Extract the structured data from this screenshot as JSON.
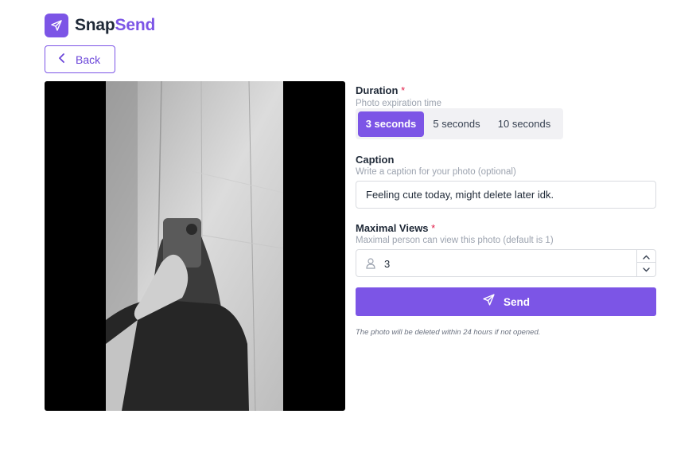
{
  "brand": {
    "name_main": "Snap",
    "name_accent": "Send",
    "logo_icon": "paper-plane-icon",
    "accent_color": "#7c55e6"
  },
  "back": {
    "label": "Back",
    "icon": "chevron-left-icon"
  },
  "photo": {
    "description_icon": "photo-preview"
  },
  "duration": {
    "label": "Duration",
    "required_mark": "*",
    "hint": "Photo expiration time",
    "options": [
      "3 seconds",
      "5 seconds",
      "10 seconds"
    ],
    "selected": "3 seconds"
  },
  "caption": {
    "label": "Caption",
    "hint": "Write a caption for your photo (optional)",
    "value": "Feeling cute today, might delete later idk."
  },
  "views": {
    "label": "Maximal Views",
    "required_mark": "*",
    "hint": "Maximal person can view this photo (default is 1)",
    "value": "3",
    "icon": "person-icon"
  },
  "send": {
    "label": "Send",
    "icon": "paper-plane-icon"
  },
  "note": "The photo will be deleted within 24 hours if not opened."
}
